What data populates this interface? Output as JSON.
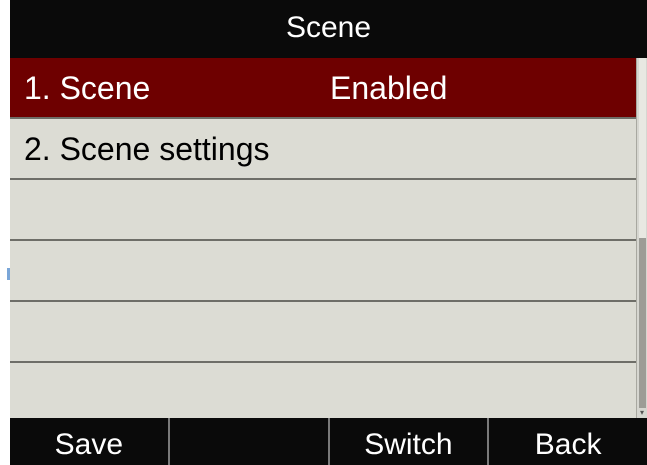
{
  "header": {
    "title": "Scene"
  },
  "menu": {
    "items": [
      {
        "label": "1. Scene",
        "value": "Enabled",
        "selected": true
      },
      {
        "label": "2. Scene settings",
        "value": "",
        "selected": false
      },
      {
        "label": "",
        "value": "",
        "selected": false
      },
      {
        "label": "",
        "value": "",
        "selected": false
      },
      {
        "label": "",
        "value": "",
        "selected": false
      },
      {
        "label": "",
        "value": "",
        "selected": false
      }
    ]
  },
  "softkeys": {
    "key1": "Save",
    "key2": "",
    "key3": "Switch",
    "key4": "Back"
  },
  "colors": {
    "title_bar": "#0a0a0a",
    "selected_row": "#6e0000",
    "list_background": "#dcdcd4",
    "softkey_bar": "#0a0a0a"
  }
}
